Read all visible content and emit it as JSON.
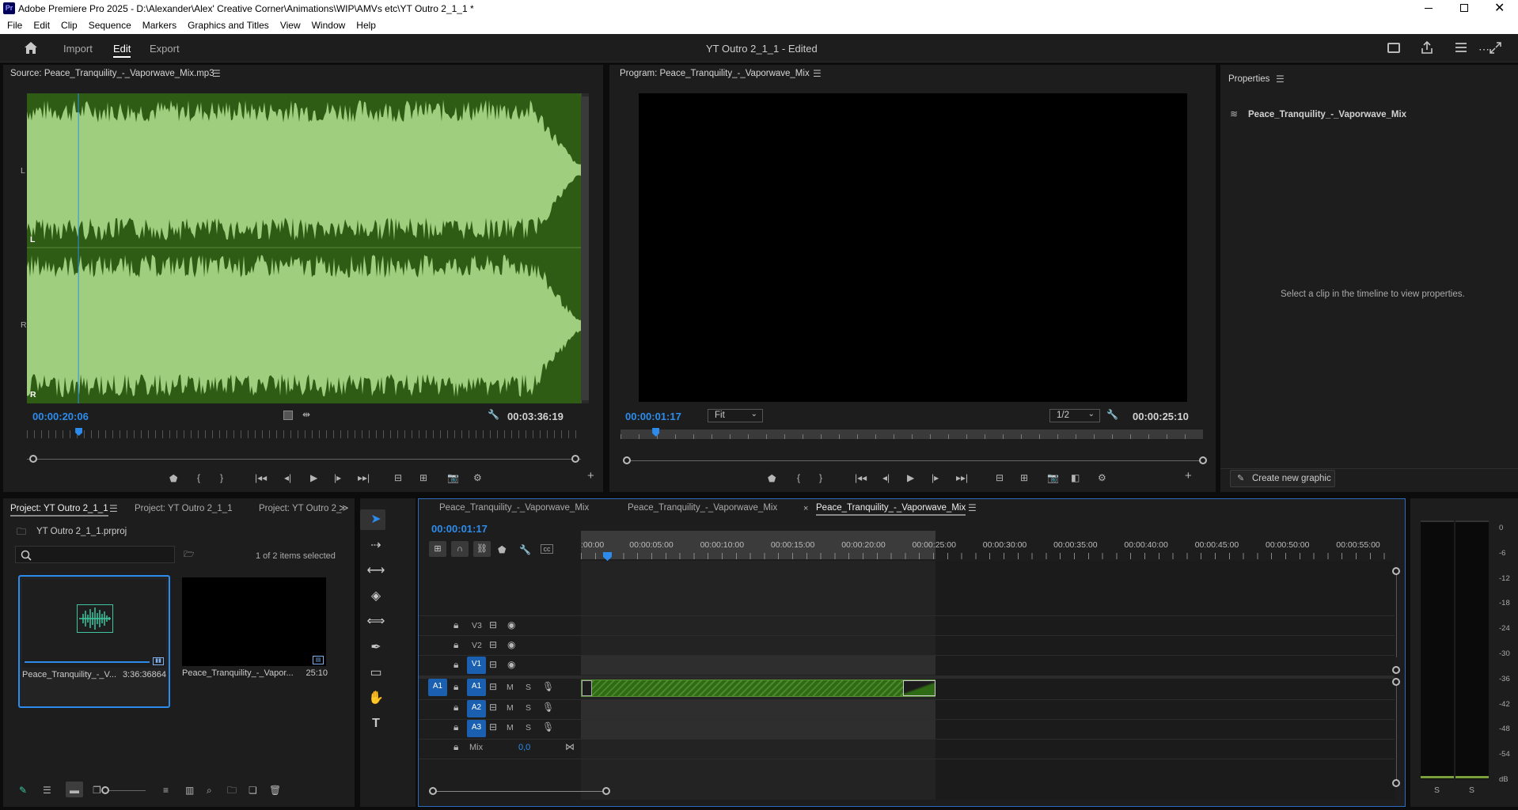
{
  "window": {
    "title": "Adobe Premiere Pro 2025 - D:\\Alexander\\Alex' Creative Corner\\Animations\\WIP\\AMVs etc\\YT Outro 2_1_1 *",
    "app_badge": "Pr"
  },
  "menu": [
    "File",
    "Edit",
    "Clip",
    "Sequence",
    "Markers",
    "Graphics and Titles",
    "View",
    "Window",
    "Help"
  ],
  "header": {
    "nav": [
      "Import",
      "Edit",
      "Export"
    ],
    "active_nav": "Edit",
    "doc_title": "YT Outro 2_1_1 - Edited"
  },
  "source": {
    "title": "Source: Peace_Tranquility_-_Vaporwave_Mix.mp3",
    "channel_left": "L",
    "channel_right": "R",
    "timecode": "00:00:20:06",
    "duration": "00:03:36:19",
    "playhead_fraction": 0.093
  },
  "program": {
    "title": "Program: Peace_Tranquility_-_Vaporwave_Mix",
    "timecode": "00:00:01:17",
    "fit": "Fit",
    "quality": "1/2",
    "duration": "00:00:25:10",
    "playhead_fraction": 0.06
  },
  "properties": {
    "title": "Properties",
    "clip_name": "Peace_Tranquility_-_Vaporwave_Mix",
    "empty_message": "Select a clip in the timeline to view properties.",
    "create_button": "Create new graphic"
  },
  "project": {
    "tabs": [
      "Project: YT Outro 2_1_1",
      "Project: YT Outro 2_1_1",
      "Project: YT Outro 2_"
    ],
    "file": "YT Outro 2_1_1.prproj",
    "search_placeholder": "",
    "selection": "1 of 2 items selected",
    "items": [
      {
        "name": "Peace_Tranquility_-_V...",
        "duration": "3:36:36864",
        "selected": true
      },
      {
        "name": "Peace_Tranquility_-_Vapor...",
        "duration": "25:10",
        "selected": false
      }
    ]
  },
  "timeline": {
    "tabs": [
      "Peace_Tranquility_-_Vaporwave_Mix",
      "Peace_Tranquility_-_Vaporwave_Mix",
      "Peace_Tranquility_-_Vaporwave_Mix"
    ],
    "active_tab": 2,
    "close_glyph": "×",
    "timecode": "00:00:01:17",
    "ruler": [
      ":00:00",
      "00:00:05:00",
      "00:00:10:00",
      "00:00:15:00",
      "00:00:20:00",
      "00:00:25:00",
      "00:00:30:00",
      "00:00:35:00",
      "00:00:40:00",
      "00:00:45:00",
      "00:00:50:00",
      "00:00:55:00"
    ],
    "video_tracks": [
      "V3",
      "V2",
      "V1"
    ],
    "audio_tracks": [
      "A1",
      "A2",
      "A3"
    ],
    "source_patch": "A1",
    "mute": "M",
    "solo": "S",
    "mix_label": "Mix",
    "mix_value": "0,0"
  },
  "meter": {
    "scale": [
      "0",
      "-6",
      "-12",
      "-18",
      "-24",
      "-30",
      "-36",
      "-42",
      "-48",
      "-54",
      "dB"
    ],
    "solo_labels": [
      "S",
      "S"
    ]
  },
  "colors": {
    "accent": "#2d8ceb",
    "waveform_light": "#9fce7e",
    "waveform_dark": "#2e5c14",
    "clip_green": "#3d7a1e"
  }
}
